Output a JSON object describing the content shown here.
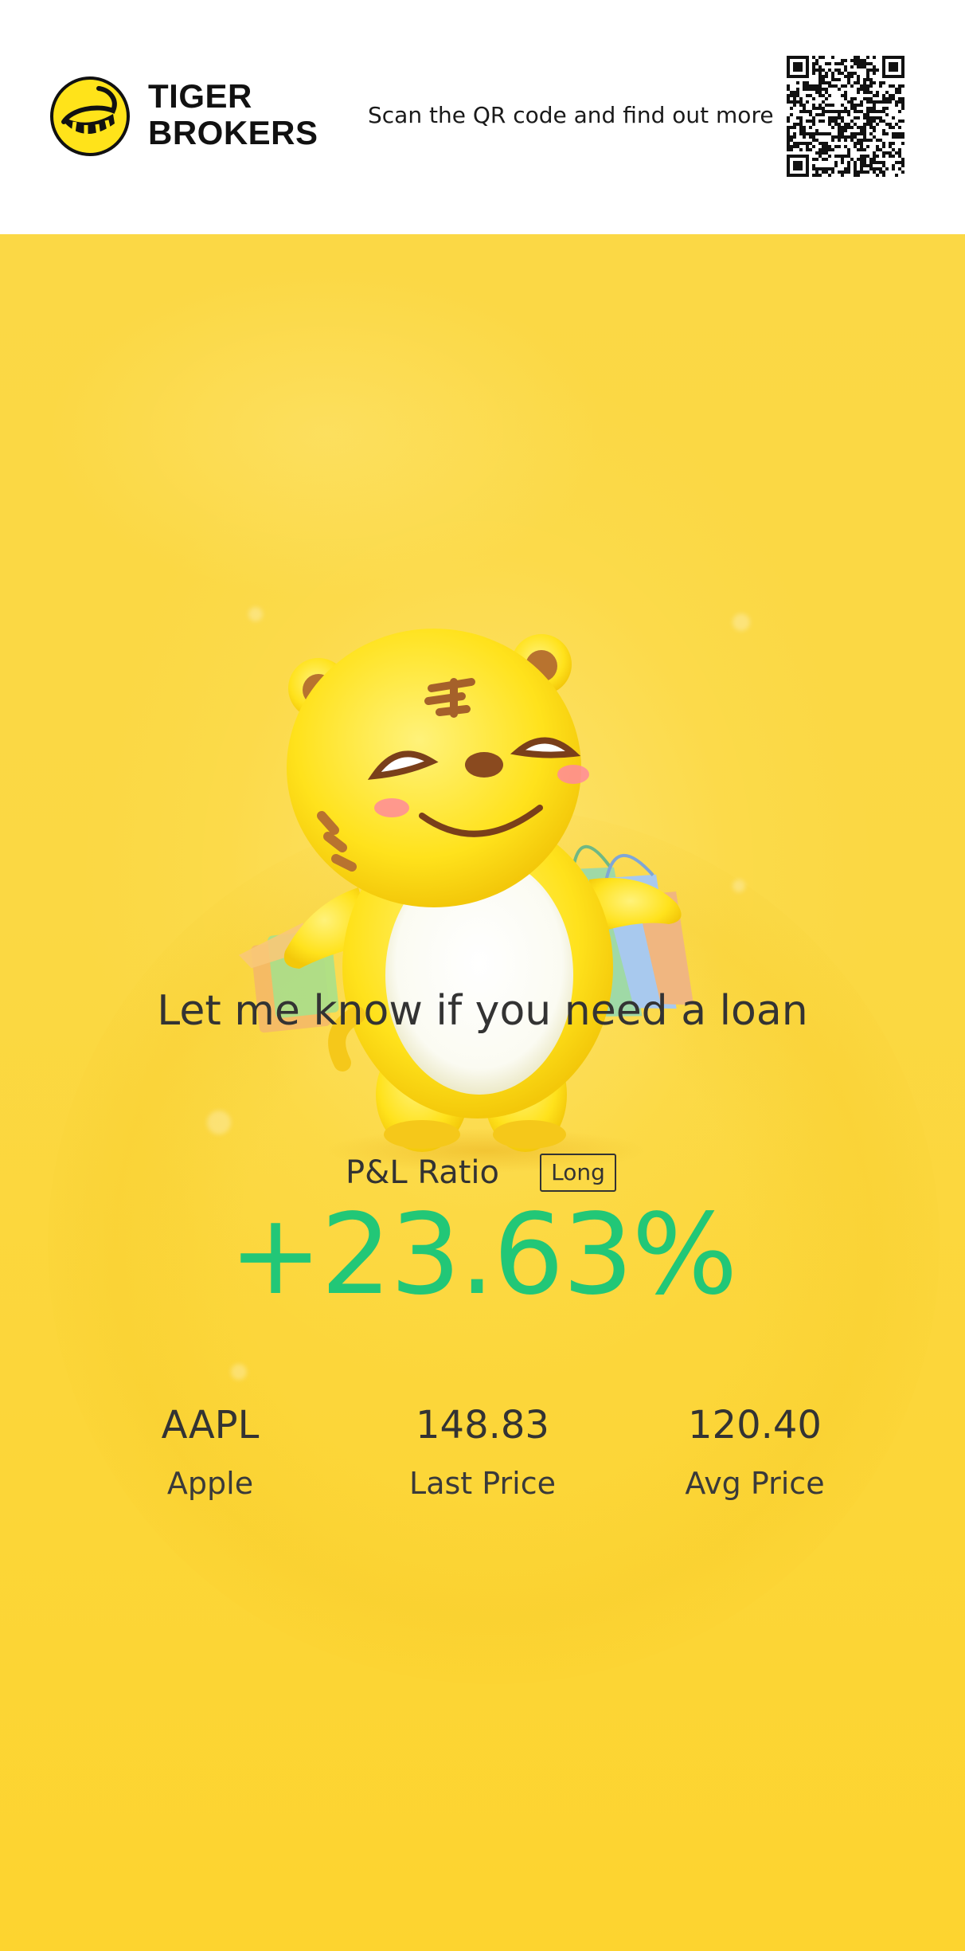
{
  "header": {
    "brand_line1": "TIGER",
    "brand_line2": "BROKERS",
    "scan_prompt": "Scan the QR code and find out more",
    "logo_icon": "tiger-logo-icon",
    "qr_icon": "qr-code-icon"
  },
  "hero": {
    "mascot_icon": "tiger-mascot-with-shopping-bags",
    "tagline": "Let me know if you need a loan"
  },
  "pnl": {
    "label": "P&L Ratio",
    "position_badge": "Long",
    "value": "+23.63%",
    "value_color": "#22c777"
  },
  "stats": [
    {
      "value": "AAPL",
      "caption": "Apple"
    },
    {
      "value": "148.83",
      "caption": "Last Price"
    },
    {
      "value": "120.40",
      "caption": "Avg Price"
    }
  ],
  "colors": {
    "background_yellow": "#fbd843",
    "brand_yellow": "#ffe31a",
    "text_dark": "#333333",
    "gain_green": "#22c777"
  }
}
